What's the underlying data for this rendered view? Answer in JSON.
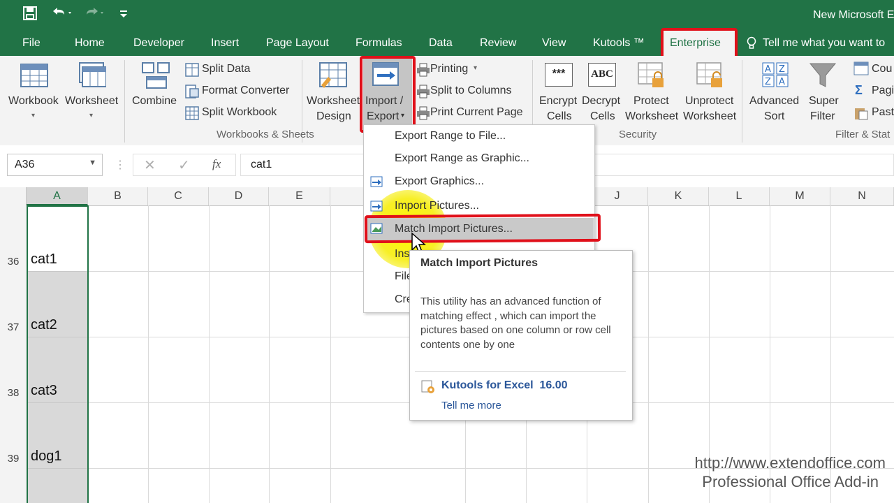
{
  "titlebar": {
    "doc_title": "New Microsoft E"
  },
  "tabs": [
    "File",
    "Home",
    "Developer",
    "Insert",
    "Page Layout",
    "Formulas",
    "Data",
    "Review",
    "View",
    "Kutools ™",
    "Enterprise"
  ],
  "tell_me": "Tell me what you want to",
  "ribbon": {
    "workbook": "Workbook",
    "worksheet": "Worksheet",
    "combine": "Combine",
    "split_data": "Split Data",
    "format_converter": "Format Converter",
    "split_workbook": "Split Workbook",
    "worksheet_design_1": "Worksheet",
    "worksheet_design_2": "Design",
    "import_1": "Import /",
    "import_2": "Export",
    "printing": "Printing",
    "split_columns": "Split to Columns",
    "print_current_page": "Print Current Page",
    "group_workbooks": "Workbooks & Sheets",
    "encrypt_1": "Encrypt",
    "encrypt_2": "Cells",
    "decrypt_1": "Decrypt",
    "decrypt_2": "Cells",
    "protect_1": "Protect",
    "protect_2": "Worksheet",
    "unprotect_1": "Unprotect",
    "unprotect_2": "Worksheet",
    "group_security": "Security",
    "advanced_1": "Advanced",
    "advanced_2": "Sort",
    "super_1": "Super",
    "super_2": "Filter",
    "group_filter": "Filter & Stat",
    "cou": "Cou",
    "pagi": "Pagi",
    "past": "Past",
    "encrypt_icon_text": "***",
    "decrypt_icon_text": "ABC"
  },
  "formula": {
    "namebox": "A36",
    "value": "cat1",
    "fx": "fx"
  },
  "columns": [
    "A",
    "B",
    "C",
    "D",
    "E",
    "J",
    "K",
    "L",
    "M",
    "N"
  ],
  "rows": [
    {
      "num": "36",
      "value": "cat1"
    },
    {
      "num": "37",
      "value": "cat2"
    },
    {
      "num": "38",
      "value": "cat3"
    },
    {
      "num": "39",
      "value": "dog1"
    }
  ],
  "menu": {
    "export_range_file": "Export Range to File...",
    "export_range_graphic": "Export Range as Graphic...",
    "export_graphics": "Export Graphics...",
    "import_pictures": "Import Pictures...",
    "match_import_pictures": "Match Import Pictures...",
    "ins": "Ins",
    "file": "File",
    "cre": "Cre"
  },
  "tooltip": {
    "title": "Match Import Pictures",
    "body": "This utility has an advanced function of matching effect , which can import the pictures based on one column or row cell contents one by one",
    "product": "Kutools for Excel  16.00",
    "more": "Tell me more"
  },
  "watermark": {
    "url": "http://www.extendoffice.com",
    "tagline": "Professional Office Add-in"
  },
  "colors": {
    "excel_green": "#217346",
    "red_highlight": "#e0101a",
    "yellow_spot": "#f7ef26"
  }
}
